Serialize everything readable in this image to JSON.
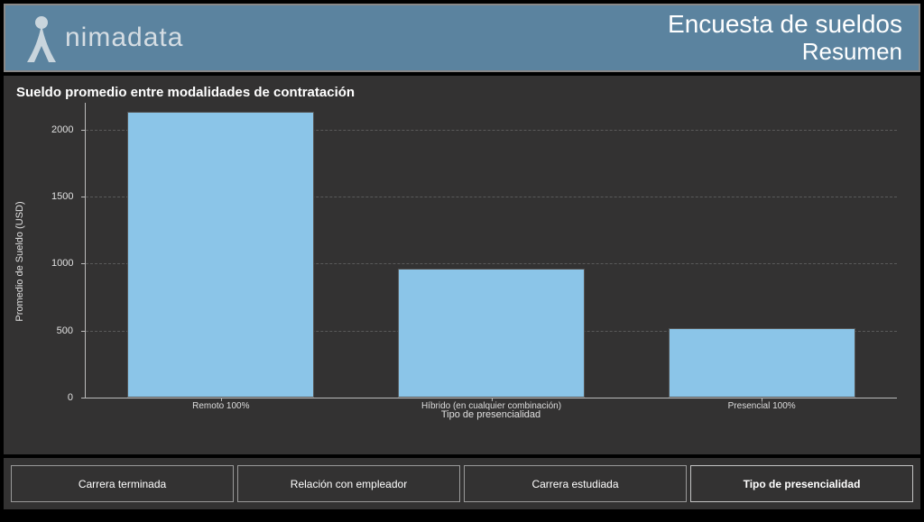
{
  "header": {
    "brand": "nimadata",
    "title1": "Encuesta de sueldos",
    "title2": "Resumen"
  },
  "chart_data": {
    "type": "bar",
    "title": "Sueldo promedio entre modalidades de contratación",
    "xlabel": "Tipo de presencialidad",
    "ylabel": "Promedio de Sueldo (USD)",
    "categories": [
      "Remoto 100%",
      "Híbrido (en cualquier combinación)",
      "Presencial 100%"
    ],
    "values": [
      2130,
      960,
      520
    ],
    "ylim": [
      0,
      2200
    ],
    "yticks": [
      0,
      500,
      1000,
      1500,
      2000
    ],
    "bar_color": "#8bc5e8"
  },
  "tabs": [
    {
      "label": "Carrera terminada",
      "active": false
    },
    {
      "label": "Relación con empleador",
      "active": false
    },
    {
      "label": "Carrera estudiada",
      "active": false
    },
    {
      "label": "Tipo de presencialidad",
      "active": true
    }
  ]
}
